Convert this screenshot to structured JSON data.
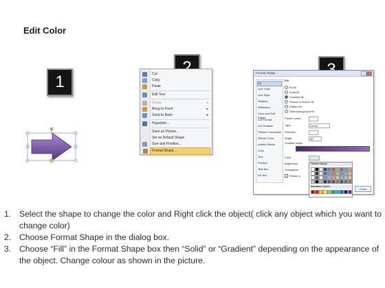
{
  "heading": "Edit Color",
  "badges": [
    "1",
    "2",
    "3"
  ],
  "context_menu": {
    "items": [
      {
        "label": "Cut",
        "icon": "scissors-icon",
        "color": "#5b7fb5"
      },
      {
        "label": "Copy",
        "icon": "copy-icon",
        "color": "#7aa0d2"
      },
      {
        "label": "Paste",
        "icon": "paste-icon",
        "color": "#c89a3a"
      },
      {
        "label": "Edit Text",
        "icon": "edit-text-icon",
        "color": "#6b8ac2"
      },
      {
        "label": "Group",
        "icon": "group-icon",
        "color": "#b4b4b4",
        "disabled": true,
        "submenu": true
      },
      {
        "label": "Bring to Front",
        "icon": "bring-front-icon",
        "color": "#d09a3c",
        "submenu": true
      },
      {
        "label": "Send to Back",
        "icon": "send-back-icon",
        "color": "#6c92c8",
        "submenu": true
      },
      {
        "label": "Hyperlink...",
        "icon": "hyperlink-icon",
        "color": "#4a76b8"
      },
      {
        "label": "Save as Picture...",
        "icon": "",
        "color": ""
      },
      {
        "label": "Set as Default Shape",
        "icon": "",
        "color": ""
      },
      {
        "label": "Size and Position...",
        "icon": "size-icon",
        "color": "#7a9bc9"
      },
      {
        "label": "Format Shape...",
        "icon": "format-shape-icon",
        "color": "#c87a3a",
        "highlighted": true
      }
    ]
  },
  "format_dialog": {
    "title": "Format Shape",
    "categories": [
      "Fill",
      "Line Color",
      "Line Style",
      "Shadow",
      "Reflection",
      "Glow and Soft Edges",
      "3-D Format",
      "3-D Rotation",
      "Picture Corrections",
      "Picture Color",
      "Artistic Effects",
      "Crop",
      "Size",
      "Position",
      "Text Box",
      "Alt Text"
    ],
    "section": "Fill",
    "fill_options": [
      "No fill",
      "Solid fill",
      "Gradient fill",
      "Picture or texture fill",
      "Pattern fill",
      "Slide background fill"
    ],
    "selected_option_index": 2,
    "preset_colors_label": "Preset colors:",
    "type_label": "Type:",
    "type_value": "Linear",
    "direction_label": "Direction:",
    "angle_label": "Angle:",
    "angle_value": "90°",
    "gradient_stops_label": "Gradient stops",
    "color_label": "Color",
    "brightness_label": "Brightness:",
    "transparency_label": "Transparen",
    "rotate_label": "Rotate w",
    "close_label": "Close",
    "gradient_colors": [
      "#4b2a66",
      "#8e6bb8"
    ]
  },
  "color_picker": {
    "theme_label": "Theme Colors",
    "standard_label": "Standard Colors",
    "theme_colors": [
      "#ffffff",
      "#000000",
      "#eeece1",
      "#1f497d",
      "#4f81bd",
      "#c0504d",
      "#9bbb59",
      "#8064a2",
      "#4bacc6",
      "#f79646"
    ],
    "standard_colors": [
      "#c00000",
      "#ff0000",
      "#ffc000",
      "#ffff00",
      "#92d050",
      "#00b050",
      "#00b0f0",
      "#0070c0",
      "#002060",
      "#7030a0"
    ]
  },
  "arrow_colors": {
    "fill_top": "#9b7fc8",
    "fill_bottom": "#5a3a86",
    "handle": "#8fd16a"
  },
  "steps": [
    {
      "num": "1.",
      "text": "Select the shape to change the color and Right click the object( click any object which you want to change color)"
    },
    {
      "num": "2.",
      "text": "Choose Format Shape in the dialog box."
    },
    {
      "num": "3.",
      "text": "Choose “Fill” in the Format Shape box then “Solid” or “Gradient” depending on the appearance of the object. Change colour as shown in the picture."
    }
  ]
}
